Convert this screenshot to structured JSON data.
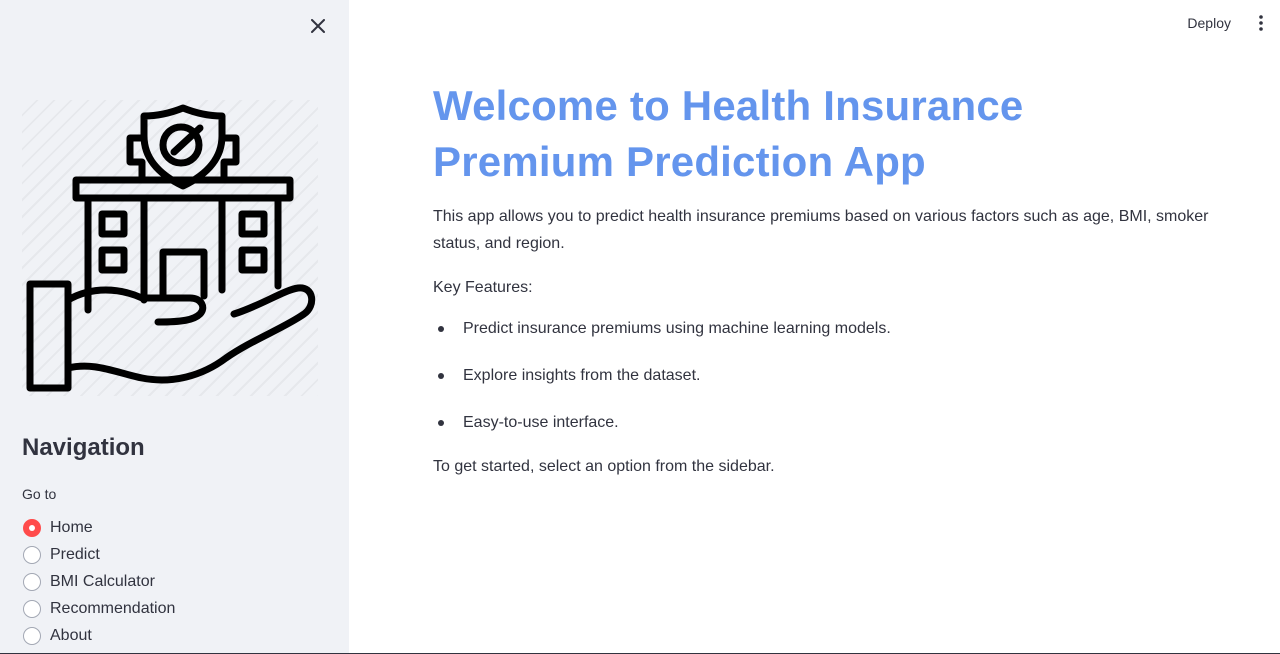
{
  "sidebar": {
    "close_icon": "close-icon",
    "logo_icon": "hand-holding-insurance-building-icon",
    "nav_title": "Navigation",
    "goto_label": "Go to",
    "options": [
      {
        "label": "Home",
        "selected": true
      },
      {
        "label": "Predict",
        "selected": false
      },
      {
        "label": "BMI Calculator",
        "selected": false
      },
      {
        "label": "Recommendation",
        "selected": false
      },
      {
        "label": "About",
        "selected": false
      }
    ]
  },
  "header": {
    "deploy_label": "Deploy",
    "menu_icon": "vertical-ellipsis-icon"
  },
  "main": {
    "title_line1": "Welcome to Health Insurance",
    "title_line2": "Premium Prediction App",
    "intro": "This app allows you to predict health insurance premiums based on various factors such as age, BMI, smoker status, and region.",
    "key_features_label": "Key Features:",
    "features": [
      "Predict insurance premiums using machine learning models.",
      "Explore insights from the dataset.",
      "Easy-to-use interface."
    ],
    "outro": "To get started, select an option from the sidebar."
  },
  "colors": {
    "title": "#6495ed",
    "sidebar_bg": "#f0f2f6",
    "radio_selected": "#ff4b4b",
    "text": "#31333f"
  }
}
